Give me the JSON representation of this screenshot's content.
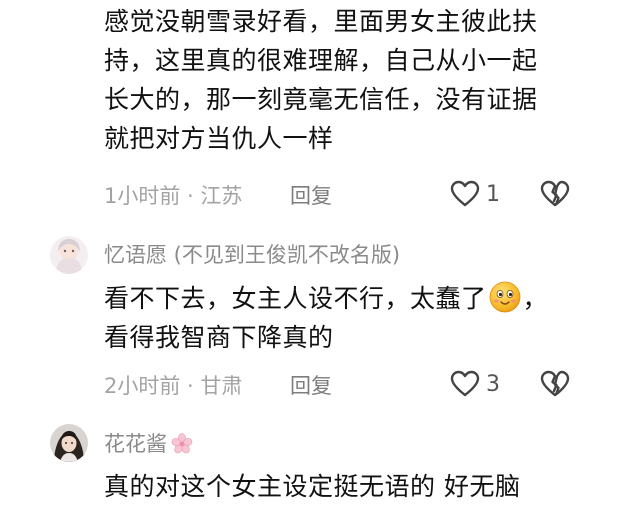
{
  "comments": [
    {
      "text_lines": [
        "感觉没朝雪录好看，里面男女主彼此扶",
        "持，这里真的很难理解，自己从小一起",
        "长大的，那一刻竟毫无信任，没有证据",
        "就把对方当仇人一样"
      ],
      "meta": "1小时前 · 江苏",
      "reply_label": "回复",
      "likes": "1"
    },
    {
      "username": "忆语愿 (不见到王俊凯不改名版)",
      "text_line1_a": "看不下去，女主人设不行，太蠢了",
      "text_line1_b": "，",
      "text_line2": "看得我智商下降真的",
      "emoji_icon": "smiling-face-emoji",
      "meta": "2小时前 · 甘肃",
      "reply_label": "回复",
      "likes": "3"
    },
    {
      "username": "花花酱",
      "badge_icon": "cherry-blossom-icon",
      "text_lines": [
        "真的对这个女主设定挺无语的 好无脑"
      ]
    }
  ],
  "colors": {
    "text": "#111111",
    "meta": "#a3a3a3",
    "username": "#8a8a8a",
    "icon": "#444444"
  }
}
